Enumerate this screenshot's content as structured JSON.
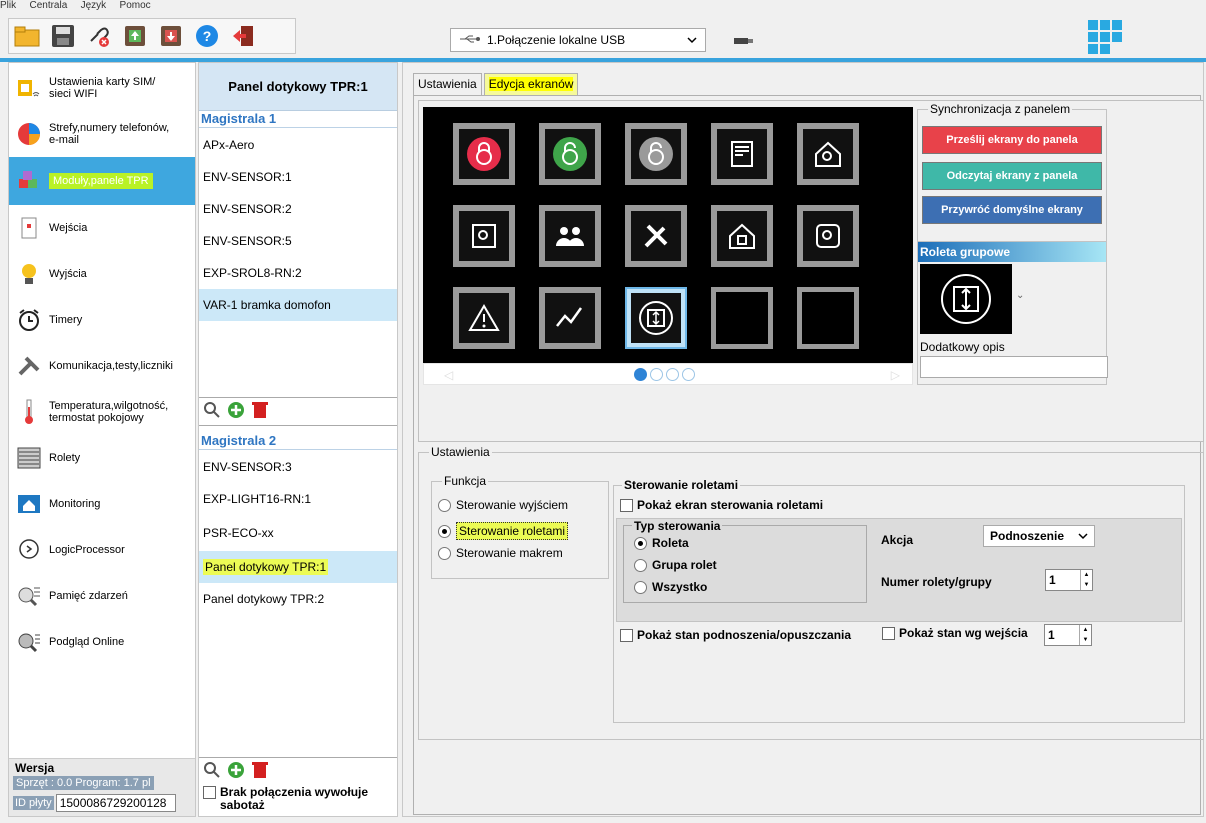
{
  "menubar": [
    "Plik",
    "Centrala",
    "Język",
    "Pomoc"
  ],
  "toolbar": {
    "connection": "1.Połączenie lokalne USB",
    "icons": [
      "folder-open-icon",
      "save-icon",
      "disconnect-icon",
      "upload-to-panel-icon",
      "download-from-panel-icon",
      "help-icon",
      "exit-icon"
    ]
  },
  "sidebar": {
    "items": [
      {
        "label": "Ustawienia karty SIM/\nsieci WIFI",
        "icon": "sim-card-icon"
      },
      {
        "label": "Strefy,numery telefonów,\ne-mail",
        "icon": "pie-chart-icon"
      },
      {
        "label": "Moduły,panele TPR",
        "icon": "modules-icon"
      },
      {
        "label": "Wejścia",
        "icon": "input-icon"
      },
      {
        "label": "Wyjścia",
        "icon": "bulb-icon"
      },
      {
        "label": "Timery",
        "icon": "alarm-clock-icon"
      },
      {
        "label": "Komunikacja,testy,liczniki",
        "icon": "tools-icon"
      },
      {
        "label": "Temperatura,wilgotność,\ntermostat pokojowy",
        "icon": "thermometer-icon"
      },
      {
        "label": "Rolety",
        "icon": "blinds-icon"
      },
      {
        "label": "Monitoring",
        "icon": "monitoring-icon"
      },
      {
        "label": "LogicProcessor",
        "icon": "head-logic-icon"
      },
      {
        "label": "Pamięć zdarzeń",
        "icon": "event-memory-icon"
      },
      {
        "label": "Podgląd Online",
        "icon": "online-preview-icon"
      }
    ],
    "version": {
      "title": "Wersja",
      "hw_prog": "Sprzęt : 0.0  Program: 1.7 pl",
      "id_label": "ID płyty",
      "id_value": "1500086729200128"
    }
  },
  "devices": {
    "header": "Panel dotykowy TPR:1",
    "bus1": {
      "title": "Magistrala 1",
      "items": [
        "APx-Aero",
        "ENV-SENSOR:1",
        "ENV-SENSOR:2",
        "ENV-SENSOR:5",
        "EXP-SROL8-RN:2",
        "VAR-1 bramka domofon"
      ]
    },
    "bus2": {
      "title": "Magistrala 2",
      "items": [
        "ENV-SENSOR:3",
        "EXP-LIGHT16-RN:1",
        "PSR-ECO-xx",
        "Panel dotykowy TPR:1",
        "Panel dotykowy TPR:2"
      ]
    },
    "footer_checkbox": "Brak połączenia wywołuje sabotaż"
  },
  "tabs": {
    "settings": "Ustawienia",
    "screen_edit": "Edycja ekranów"
  },
  "sync": {
    "legend": "Synchronizacja z panelem",
    "send": "Prześlij ekrany do panela",
    "read": "Odczytaj ekrany z panela",
    "restore": "Przywróć domyślne ekrany",
    "colors": {
      "send": "#e8424a",
      "read": "#3fb8a8",
      "restore": "#3d6fb3"
    }
  },
  "roleta": {
    "title": "Roleta grupowe",
    "extra_label": "Dodatkowy opis",
    "extra_value": ""
  },
  "settings_section": {
    "legend": "Ustawienia",
    "function": {
      "legend": "Funkcja",
      "options": [
        "Sterowanie wyjściem",
        "Sterowanie roletami",
        "Sterowanie makrem"
      ],
      "selected": 1
    },
    "blinds": {
      "legend": "Sterowanie roletami",
      "show_screen": "Pokaż ekran sterowania roletami",
      "type_legend": "Typ sterowania",
      "type_options": [
        "Roleta",
        "Grupa rolet",
        "Wszystko"
      ],
      "type_selected": 0,
      "action_label": "Akcja",
      "action_value": "Podnoszenie",
      "number_label": "Numer rolety/grupy",
      "number_value": "1",
      "show_state": "Pokaż stan podnoszenia/opuszczania",
      "show_state_input": "Pokaż stan wg wejścia",
      "state_input_value": "1"
    }
  }
}
